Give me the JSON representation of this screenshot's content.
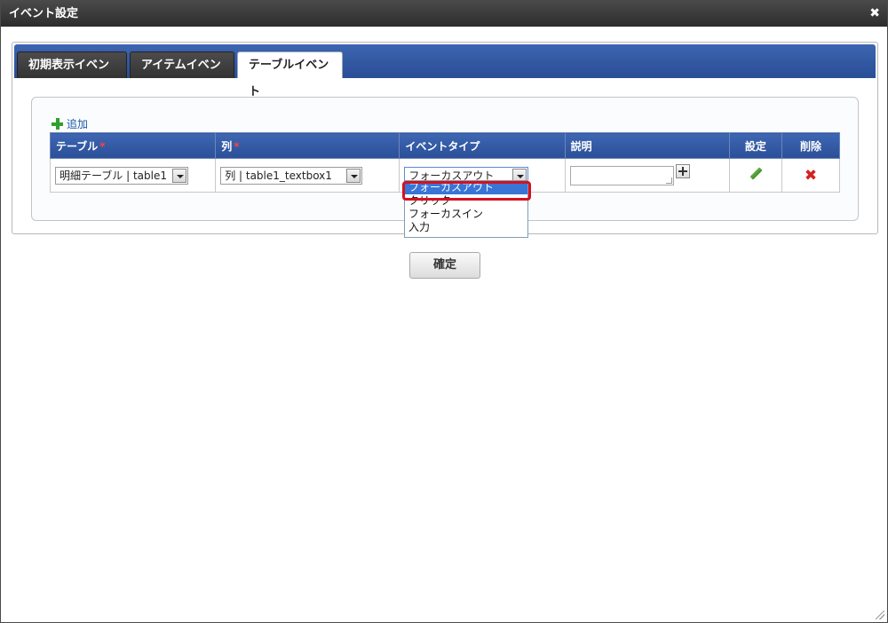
{
  "dialog": {
    "title": "イベント設定",
    "close_glyph": "✖"
  },
  "tabs": [
    {
      "label": "初期表示イベント",
      "active": false
    },
    {
      "label": "アイテムイベント",
      "active": false
    },
    {
      "label": "テーブルイベント",
      "active": true
    }
  ],
  "add_label": "追加",
  "table": {
    "headers": {
      "table": "テーブル",
      "column": "列",
      "event_type": "イベントタイプ",
      "description": "説明",
      "settings": "設定",
      "delete": "削除"
    },
    "required_mark": "*",
    "rows": [
      {
        "table_value": "明細テーブル | table1",
        "column_value": "列 | table1_textbox1",
        "event_type_value": "フォーカスアウト",
        "description_value": ""
      }
    ]
  },
  "event_type_dropdown": {
    "options": [
      "フォーカスアウト",
      "クリック",
      "フォーカスイン",
      "入力"
    ],
    "selected": "フォーカスアウト"
  },
  "confirm_label": "確定",
  "colors": {
    "tab_bar": "#2a4d96",
    "header_bg": "#3e66b2",
    "highlight": "#d4121e",
    "selected_option": "#3875d7",
    "add_icon": "#2fa02f",
    "delete_icon": "#d42020"
  }
}
